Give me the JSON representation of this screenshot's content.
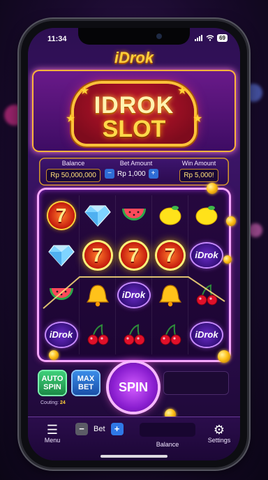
{
  "status_bar": {
    "time": "11:34",
    "battery": "69"
  },
  "app": {
    "title": "iDrok"
  },
  "logo": {
    "line1": "IDROK",
    "line2": "SLOT"
  },
  "info": {
    "balance_label": "Balance",
    "balance_value": "Rp 50,000,000",
    "bet_label": "Bet Amount",
    "bet_value": "Rp 1,000",
    "bet_minus": "−",
    "bet_plus": "+",
    "win_label": "Win Amount",
    "win_value": "Rp 5,000!"
  },
  "reels": {
    "rows": [
      [
        "seven",
        "diamond",
        "watermelon",
        "lemon",
        "lemon"
      ],
      [
        "diamond",
        "seven",
        "seven",
        "seven",
        "idrok"
      ],
      [
        "watermelon",
        "bell",
        "idrok",
        "bell",
        "cherry"
      ],
      [
        "idrok",
        "cherry",
        "cherry",
        "cherry",
        "idrok"
      ]
    ],
    "seven_label": "7",
    "idrok_label": "iDrok"
  },
  "controls": {
    "auto_spin": "AUTO SPIN",
    "max_bet": "MAX BET",
    "spin": "SPIN",
    "counting_label": "Couting:",
    "counting_value": "24"
  },
  "tabbar": {
    "menu": "Menu",
    "bet_minus": "−",
    "bet_label": "Bet",
    "bet_plus": "+",
    "balance": "Balance",
    "settings": "Settings"
  },
  "colors": {
    "accent_gold": "#ffcf3a",
    "accent_purple": "#8a1ed0",
    "spin_pink": "#f6b8ff"
  }
}
